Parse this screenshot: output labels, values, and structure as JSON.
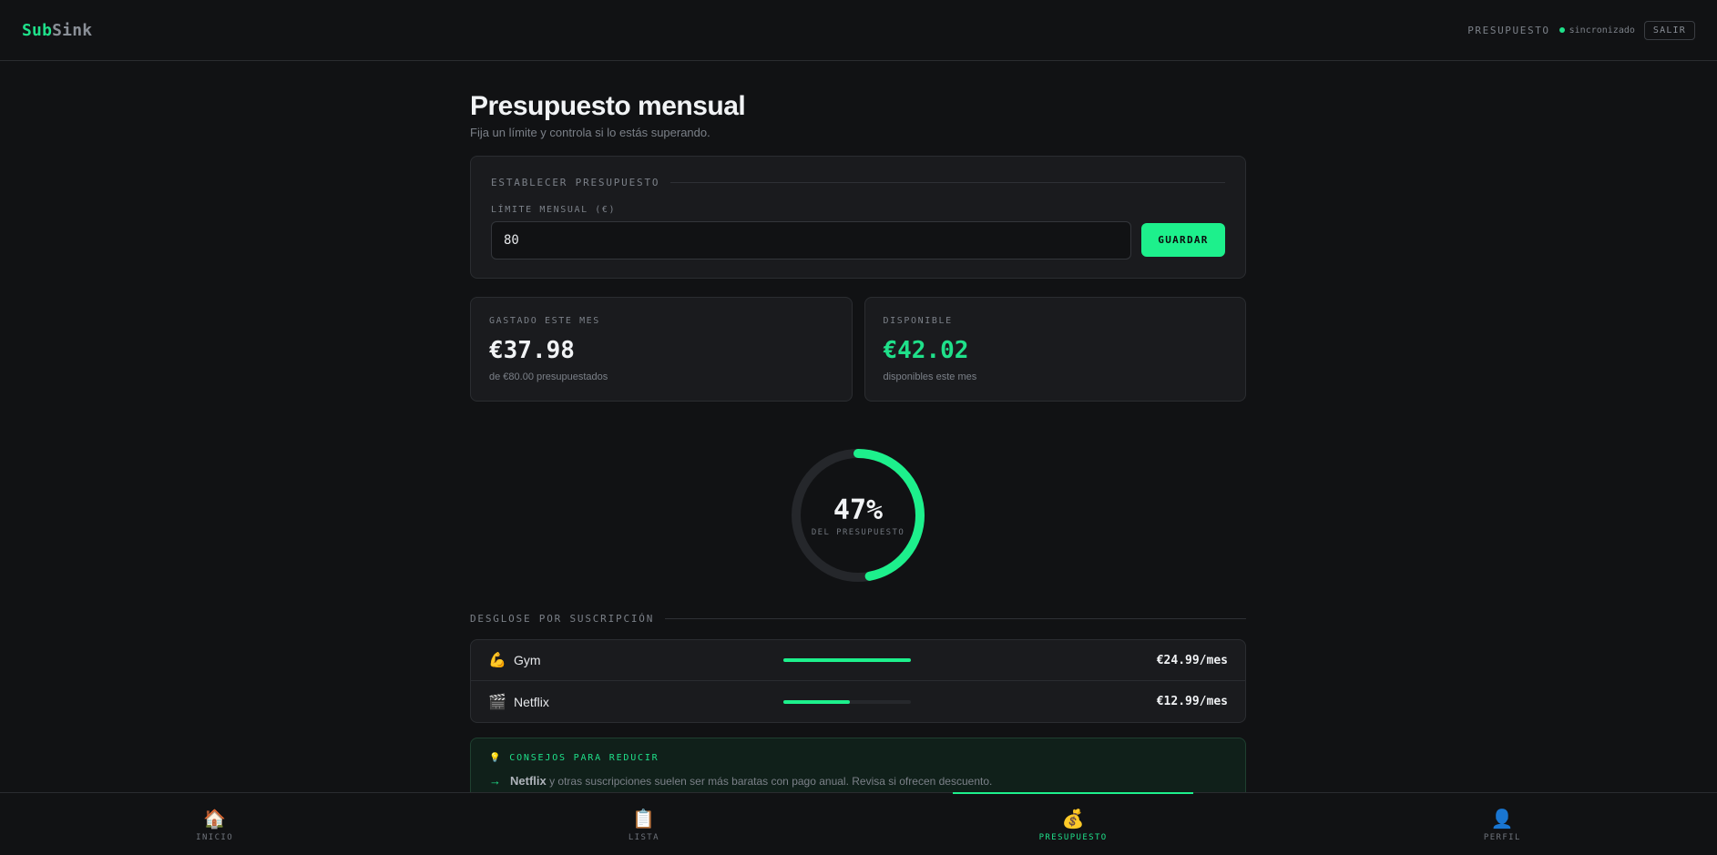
{
  "header": {
    "logo_part1": "Sub",
    "logo_part2": "Sink",
    "section_label": "PRESUPUESTO",
    "sync_status": "sincronizado",
    "logout_label": "SALIR"
  },
  "page": {
    "title": "Presupuesto mensual",
    "subtitle": "Fija un límite y controla si lo estás superando."
  },
  "budget_form": {
    "section_title": "ESTABLECER PRESUPUESTO",
    "field_label": "LÍMITE MENSUAL (€)",
    "value": "80",
    "save_label": "GUARDAR"
  },
  "stats": {
    "spent": {
      "label": "GASTADO ESTE MES",
      "value": "€37.98",
      "sub": "de €80.00 presupuestados"
    },
    "available": {
      "label": "DISPONIBLE",
      "value": "€42.02",
      "sub": "disponibles este mes"
    }
  },
  "progress": {
    "percent_text": "47%",
    "fraction": 0.47,
    "caption": "DEL PRESUPUESTO"
  },
  "breakdown": {
    "title": "DESGLOSE POR SUSCRIPCIÓN",
    "items": [
      {
        "emoji": "💪",
        "name": "Gym",
        "price": "€24.99/mes",
        "share": 1.0
      },
      {
        "emoji": "🎬",
        "name": "Netflix",
        "price": "€12.99/mes",
        "share": 0.52
      }
    ]
  },
  "tips": {
    "icon": "💡",
    "title": "CONSEJOS PARA REDUCIR",
    "items": [
      {
        "bold": "Netflix",
        "text": " y otras suscripciones suelen ser más baratas con pago anual. Revisa si ofrecen descuento."
      }
    ]
  },
  "nav": {
    "items": [
      {
        "icon": "🏠",
        "label": "INICIO"
      },
      {
        "icon": "📋",
        "label": "LISTA"
      },
      {
        "icon": "💰",
        "label": "PRESUPUESTO"
      },
      {
        "icon": "👤",
        "label": "PERFIL"
      }
    ]
  },
  "colors": {
    "accent": "#1df08c",
    "background": "#111214",
    "card": "#1a1b1e"
  }
}
